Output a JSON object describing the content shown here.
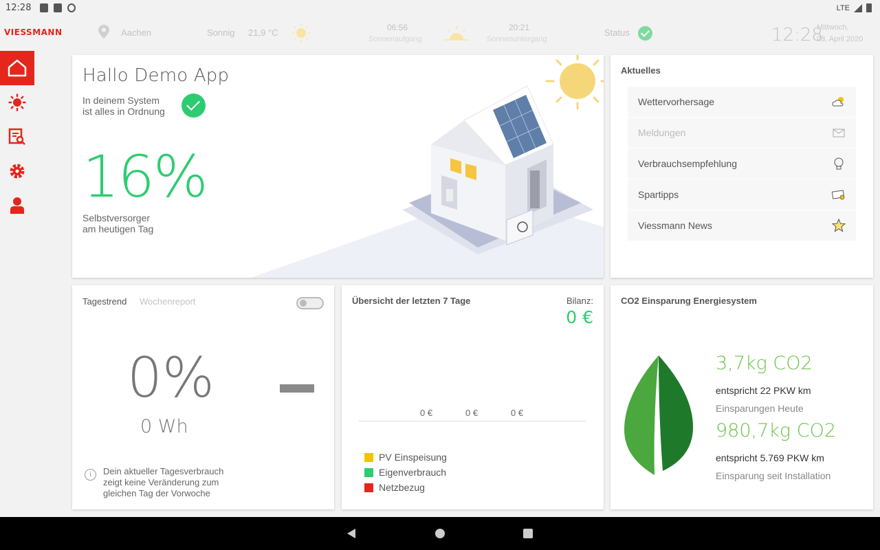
{
  "statusbar": {
    "time": "12:28",
    "network": "LTE"
  },
  "topbar": {
    "brand": "VIESSMANN",
    "location": "Aachen",
    "weather": "Sonnig",
    "temperature": "21,9 °C",
    "sunrise_time": "06:56",
    "sunrise_label": "Sonnenaufgang",
    "sunset_time": "20:21",
    "sunset_label": "Sonnenuntergang",
    "status_label": "Status",
    "clock": "12:28",
    "weekday": "Mittwoch,",
    "date": "08. April 2020"
  },
  "sidebar": {
    "items": [
      {
        "icon": "home-icon",
        "active": true
      },
      {
        "icon": "sun-icon",
        "active": false
      },
      {
        "icon": "report-search-icon",
        "active": false
      },
      {
        "icon": "gear-icon",
        "active": false
      },
      {
        "icon": "user-icon",
        "active": false
      }
    ]
  },
  "main": {
    "greeting": "Hallo Demo App",
    "status_line1": "In deinem System",
    "status_line2": "ist alles in Ordnung",
    "self_sufficiency": "16%",
    "self_label_line1": "Selbstversorger",
    "self_label_line2": "am heutigen Tag"
  },
  "news": {
    "title": "Aktuelles",
    "items": [
      {
        "label": "Wettervorhersage",
        "icon": "weather-cloud-sun-icon"
      },
      {
        "label": "Meldungen",
        "icon": "mail-icon"
      },
      {
        "label": "Verbrauchsempfehlung",
        "icon": "lightbulb-icon"
      },
      {
        "label": "Spartipps",
        "icon": "money-tip-icon"
      },
      {
        "label": "Viessmann News",
        "icon": "star-icon"
      }
    ]
  },
  "trend": {
    "tab_daily": "Tagestrend",
    "tab_weekly": "Wochenreport",
    "percent": "0%",
    "energy": "0 Wh",
    "note_line1": "Dein aktueller Tagesverbrauch",
    "note_line2": "zeigt keine Veränderung zum",
    "note_line3": "gleichen Tag der Vorwoche"
  },
  "week": {
    "title": "Übersicht der letzten 7 Tage",
    "balance_label": "Bilanz:",
    "balance_value": "0 €",
    "bar_labels": [
      "0 €",
      "0 €",
      "0 €"
    ],
    "legend": [
      {
        "label": "PV Einspeisung",
        "color": "#f5c200"
      },
      {
        "label": "Eigenverbrauch",
        "color": "#2ecc71"
      },
      {
        "label": "Netzbezug",
        "color": "#e4261c"
      }
    ]
  },
  "co2": {
    "title": "CO2 Einsparung Energiesystem",
    "today_value": "3,7kg CO2",
    "today_equiv": "entspricht 22 PKW km",
    "today_label": "Einsparungen Heute",
    "total_value": "980,7kg CO2",
    "total_equiv": "entspricht 5.769 PKW km",
    "total_label": "Einsparung seit Installation"
  },
  "colors": {
    "brand": "#e4261c",
    "accent_green": "#2ecc71",
    "leaf_green": "#6cc24a"
  }
}
